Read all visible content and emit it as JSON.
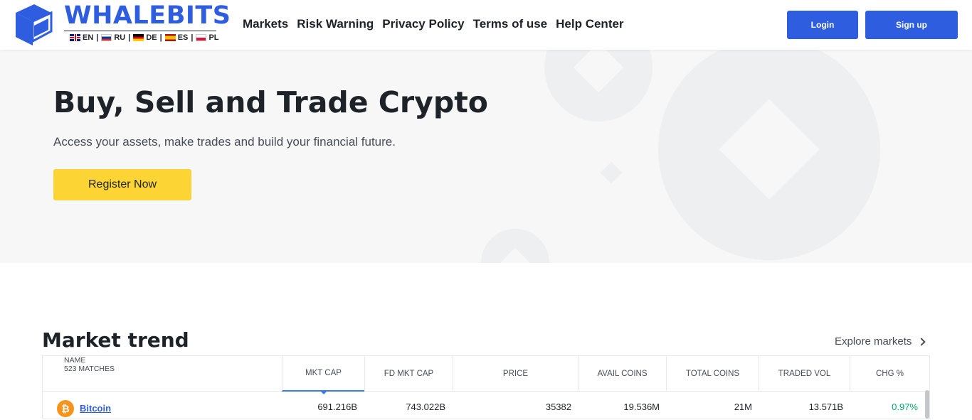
{
  "header": {
    "brand": "WHALEBITS",
    "languages": [
      {
        "code": "EN",
        "flag": "uk-flag-icon"
      },
      {
        "code": "RU",
        "flag": "ru-flag-icon"
      },
      {
        "code": "DE",
        "flag": "de-flag-icon"
      },
      {
        "code": "ES",
        "flag": "es-flag-icon"
      },
      {
        "code": "PL",
        "flag": "pl-flag-icon"
      }
    ],
    "nav": [
      "Markets",
      "Risk Warning",
      "Privacy Policy",
      "Terms of use",
      "Help Center"
    ],
    "login": "Login",
    "signup": "Sign up"
  },
  "hero": {
    "title": "Buy, Sell and Trade Crypto",
    "subtitle": "Access your assets, make trades and build your financial future.",
    "cta": "Register Now"
  },
  "market": {
    "title": "Market trend",
    "explore": "Explore markets",
    "columns": {
      "name": "NAME",
      "matches": "523 MATCHES",
      "mkt_cap": "MKT CAP",
      "fd_mkt_cap": "FD MKT CAP",
      "price": "PRICE",
      "avail_coins": "AVAIL COINS",
      "total_coins": "TOTAL COINS",
      "traded_vol": "TRADED VOL",
      "chg": "CHG %"
    },
    "rows": [
      {
        "icon": "bitcoin-icon",
        "name": "Bitcoin",
        "mkt_cap": "691.216B",
        "fd_mkt_cap": "743.022B",
        "price": "35382",
        "avail_coins": "19.536M",
        "total_coins": "21M",
        "traded_vol": "13.571B",
        "chg": "0.97%"
      }
    ]
  },
  "colors": {
    "brand_blue": "#2f5de0",
    "cta_yellow": "#fcd535",
    "positive_green": "#03a66d"
  }
}
